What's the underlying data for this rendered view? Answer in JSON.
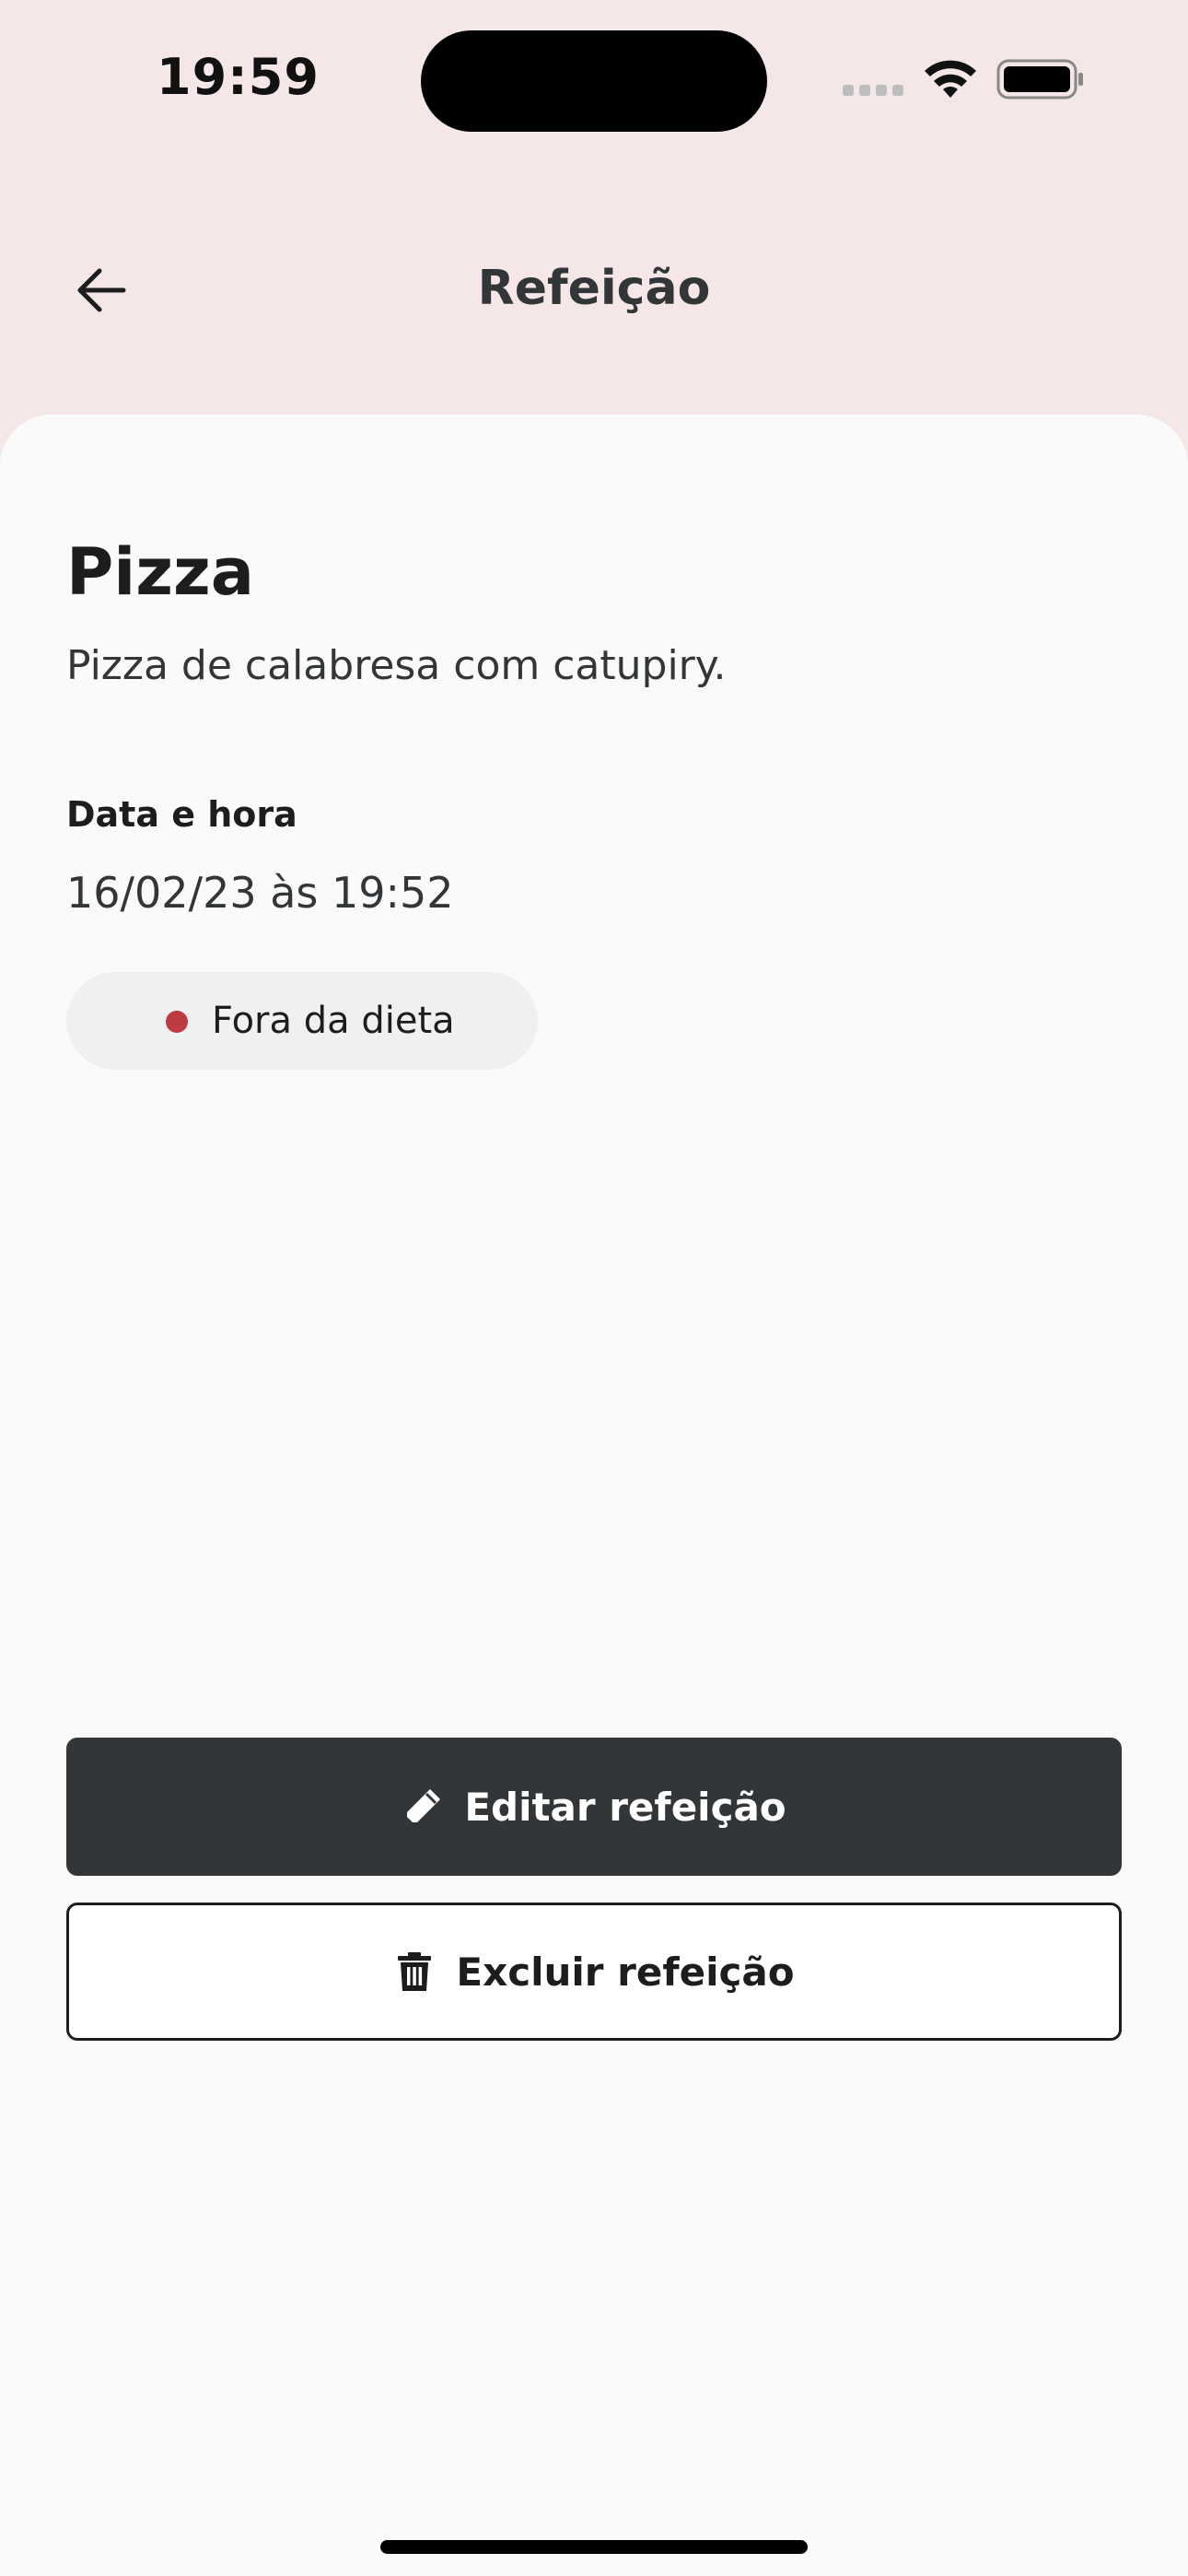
{
  "status_bar": {
    "time": "19:59"
  },
  "header": {
    "title": "Refeição",
    "back_icon": "arrow-left-icon"
  },
  "meal": {
    "name": "Pizza",
    "description": "Pizza de calabresa com catupiry.",
    "datetime_label": "Data e hora",
    "datetime_value": "16/02/23 às 19:52",
    "diet_status": {
      "label": "Fora da dieta",
      "dot_color": "#BF3B44"
    }
  },
  "actions": {
    "edit": {
      "label": "Editar refeição",
      "icon": "pencil-icon"
    },
    "delete": {
      "label": "Excluir refeição",
      "icon": "trash-icon"
    }
  },
  "colors": {
    "header_bg": "#F5E6E7",
    "card_bg": "#FAFAFA",
    "primary_button": "#333638",
    "badge_bg": "#EFF0F0"
  }
}
